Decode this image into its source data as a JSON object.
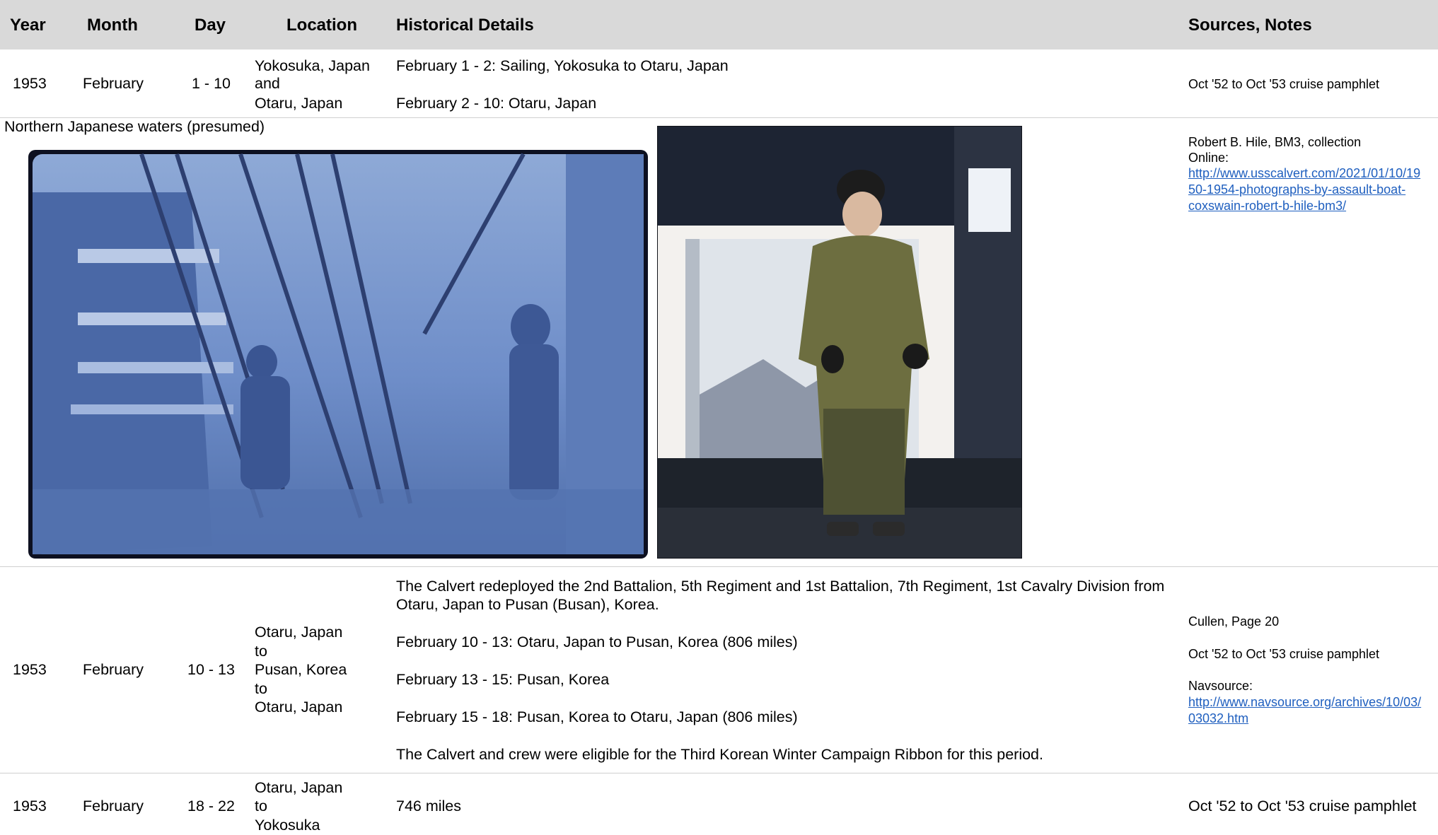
{
  "headers": {
    "year": "Year",
    "month": "Month",
    "day": "Day",
    "location": "Location",
    "details": "Historical Details",
    "sources": "Sources, Notes"
  },
  "row1": {
    "year": "1953",
    "month": "February",
    "day": "1 - 10",
    "location": [
      "Yokosuka, Japan",
      "and",
      "Otaru, Japan"
    ],
    "details": [
      "February 1 - 2: Sailing, Yokosuka to Otaru, Japan",
      "February 2 - 10: Otaru, Japan"
    ],
    "source": "Oct '52 to Oct '53 cruise pamphlet"
  },
  "photo_row": {
    "caption": "Northern Japanese waters (presumed)",
    "source_lines": [
      "Robert B. Hile, BM3, collection",
      "Online:"
    ],
    "link_lines": [
      "http://www.usscalvert.com/2021/01/10/19",
      "50-1954-photographs-by-assault-boat-",
      "coxswain-robert-b-hile-bm3/"
    ]
  },
  "row2": {
    "year": "1953",
    "month": "February",
    "day": "10 - 13",
    "location": [
      "Otaru, Japan",
      "to",
      "Pusan, Korea",
      "to",
      "Otaru, Japan"
    ],
    "details": [
      "The Calvert redeployed the 2nd Battalion, 5th Regiment and 1st Battalion, 7th Regiment, 1st Cavalry Division from",
      "Otaru, Japan to Pusan (Busan), Korea.",
      "February 10 - 13: Otaru, Japan to Pusan, Korea (806 miles)",
      "February 13 - 15: Pusan, Korea",
      "February 15 - 18: Pusan, Korea to Otaru, Japan (806 miles)",
      "The Calvert and crew were eligible for the Third Korean Winter Campaign Ribbon for this period."
    ],
    "sources": [
      "Cullen, Page 20",
      "Oct '52 to Oct '53 cruise pamphlet",
      "Navsource:"
    ],
    "link_lines": [
      "http://www.navsource.org/archives/10/03/",
      "03032.htm"
    ]
  },
  "row3": {
    "year": "1953",
    "month": "February",
    "day": "18 - 22",
    "location": [
      "Otaru, Japan",
      "to",
      "Yokosuka"
    ],
    "details": "746 miles",
    "source": "Oct '52 to Oct '53 cruise pamphlet"
  },
  "colors": {
    "header_bg": "#d9d9d9",
    "link": "#1f5fbf",
    "rule": "#cfcfcf"
  }
}
